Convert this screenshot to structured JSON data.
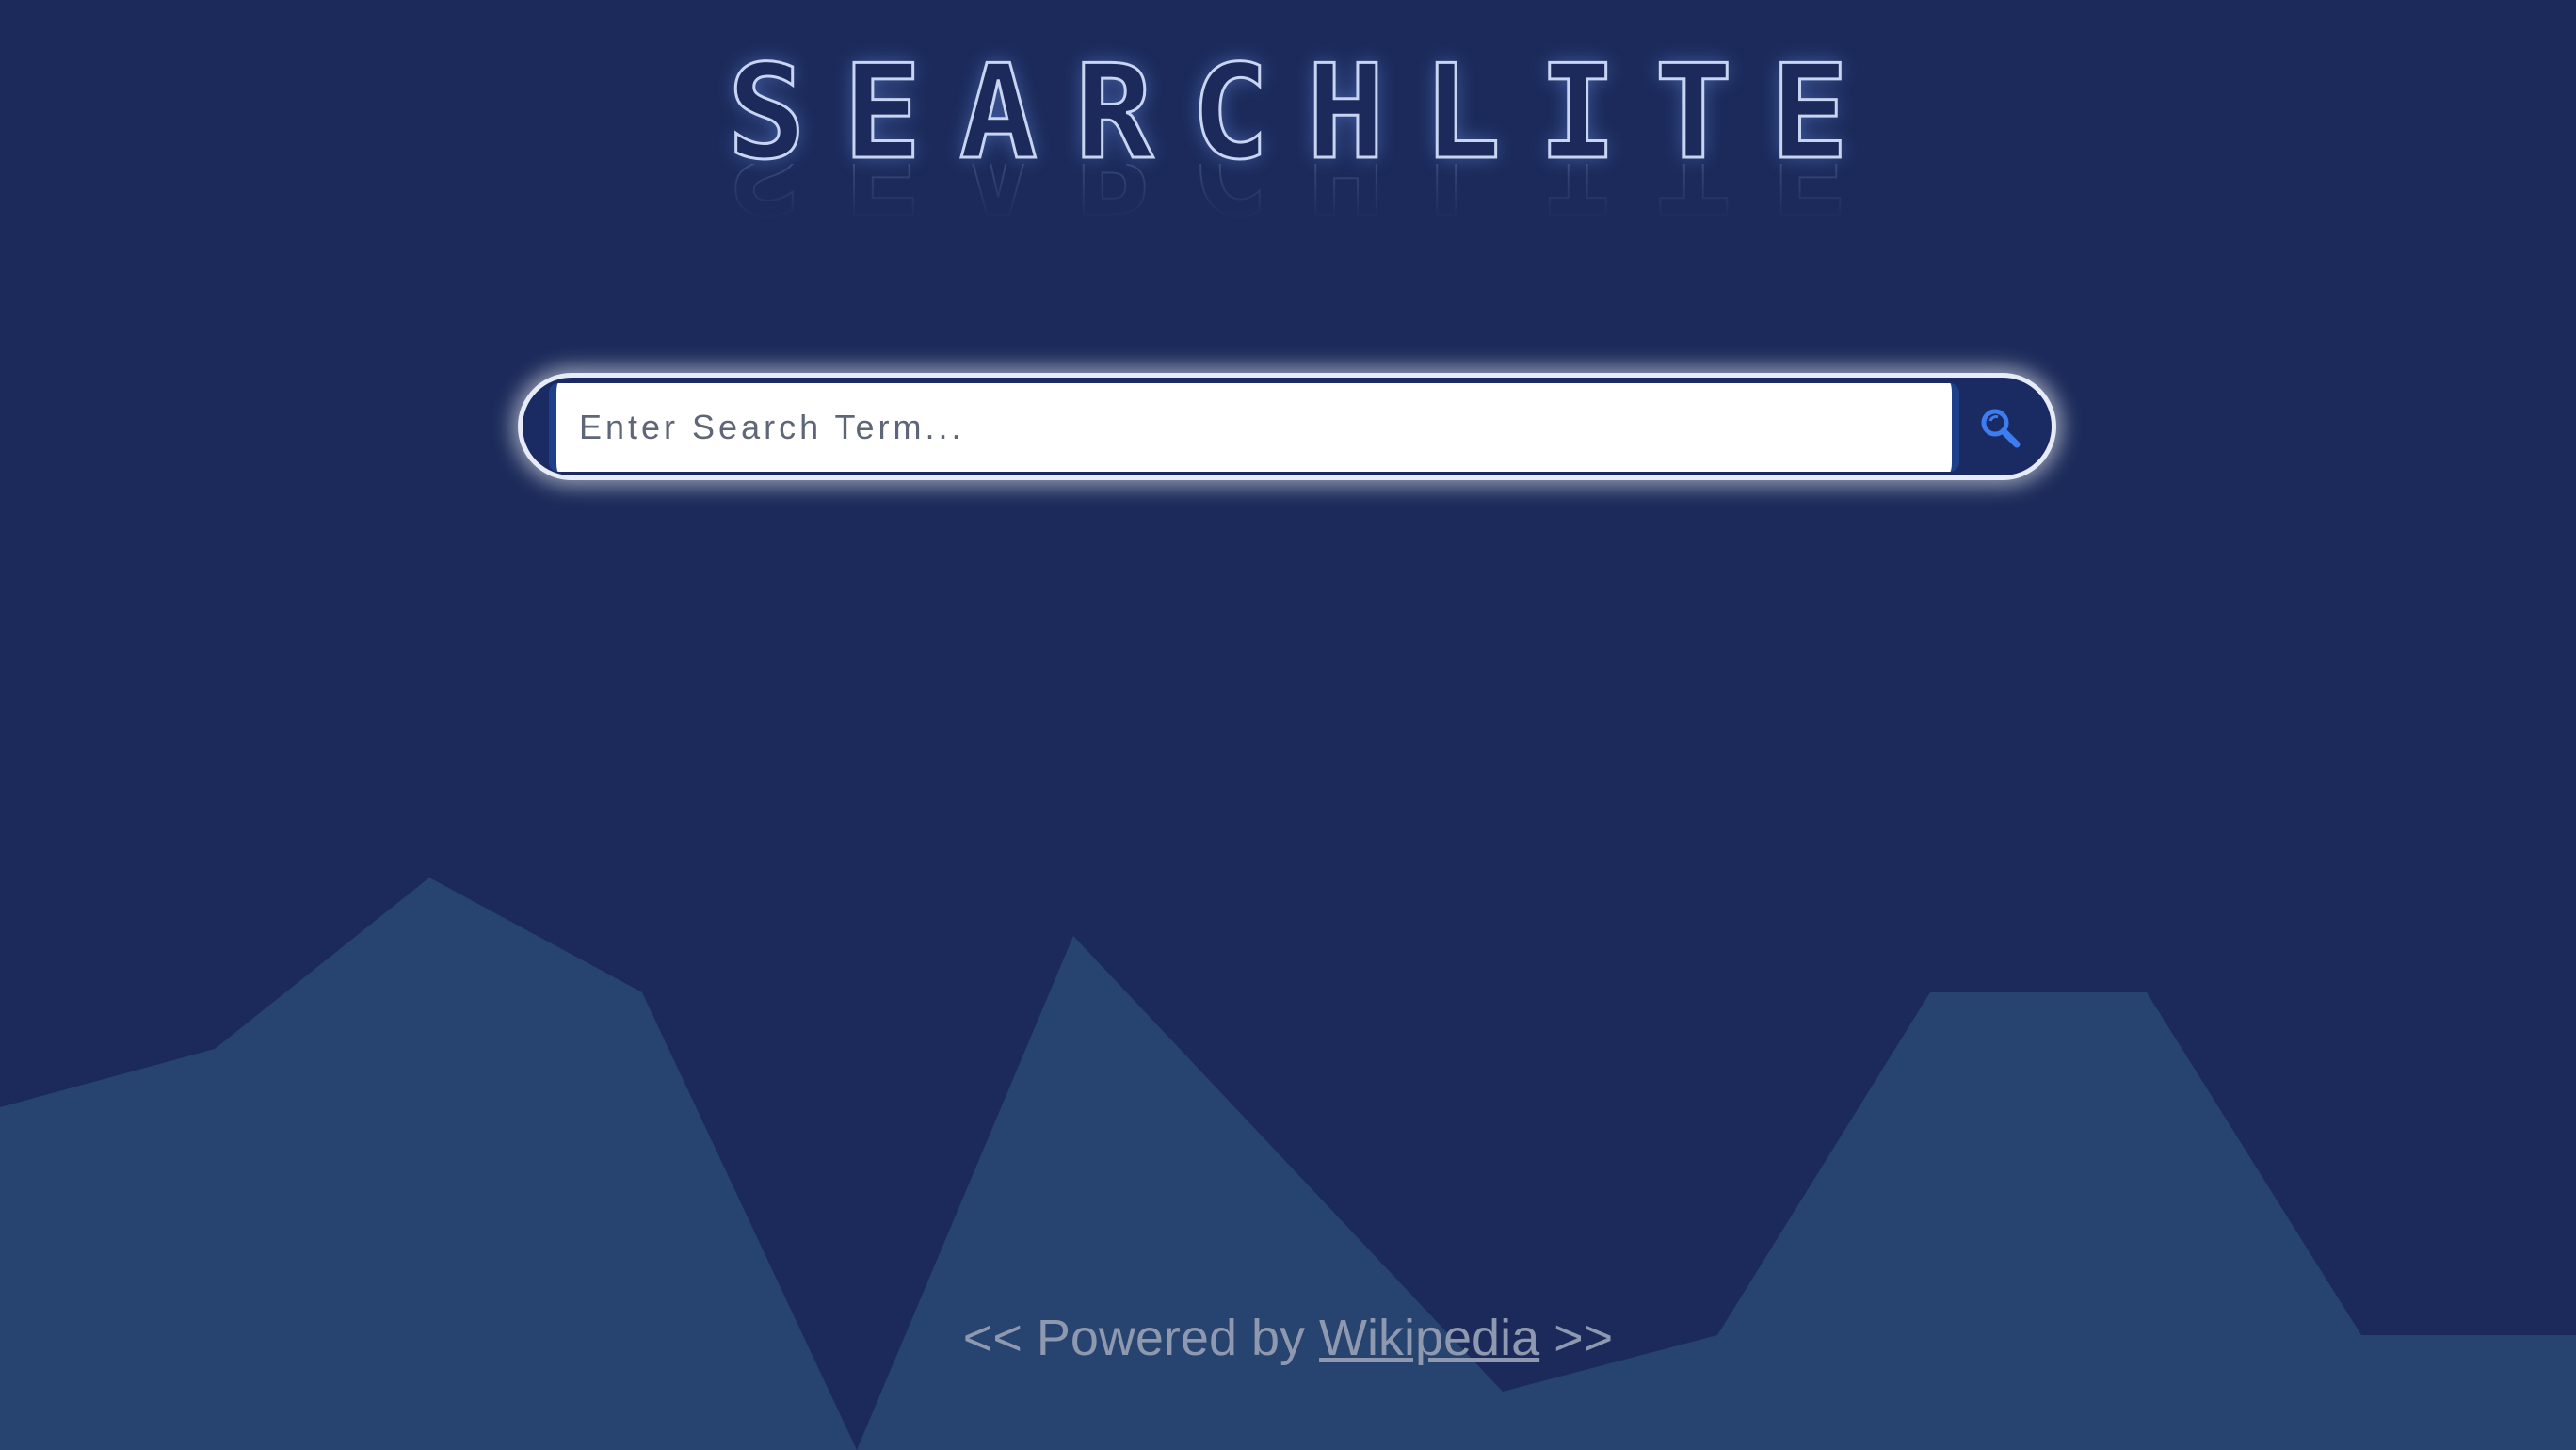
{
  "app": {
    "logo_text": "SEARCHLITE"
  },
  "search": {
    "placeholder": "Enter Search Term...",
    "value": "",
    "button_icon": "search-icon"
  },
  "footer": {
    "prefix": "<< Powered by ",
    "link_text": "Wikipedia",
    "suffix": " >>"
  },
  "colors": {
    "background": "#1b2a5a",
    "mountains": "#27436f",
    "accent": "#3d7df0",
    "search_border": "#e6ebf7"
  }
}
